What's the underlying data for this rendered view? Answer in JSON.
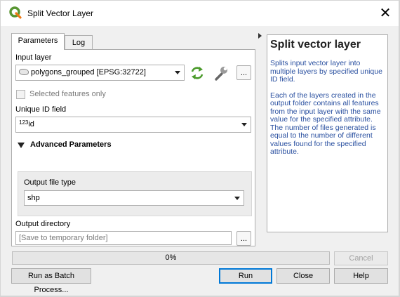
{
  "window": {
    "title": "Split Vector Layer",
    "close_glyph": "✕"
  },
  "tabs": [
    {
      "label": "Parameters"
    },
    {
      "label": "Log"
    }
  ],
  "params": {
    "input_layer_label": "Input layer",
    "input_layer_value": "polygons_grouped [EPSG:32722]",
    "selected_only_label": "Selected features only",
    "unique_id_label": "Unique ID field",
    "unique_id_type_badge": "123",
    "unique_id_value": "id",
    "advanced_label": "Advanced Parameters",
    "output_type_label": "Output file type",
    "output_type_value": "shp",
    "output_dir_label": "Output directory",
    "output_dir_placeholder": "[Save to temporary folder]",
    "browse_label": "..."
  },
  "help": {
    "title": "Split vector layer",
    "para1": "Splits input vector layer into multiple layers by specified unique ID field.",
    "para2": "Each of the layers created in the output folder contains all features from the input layer with the same value for the specified attribute. The number of files generated is equal to the number of different values found for the specified attribute."
  },
  "progress": {
    "text": "0%",
    "value": 0
  },
  "buttons": {
    "cancel": "Cancel",
    "batch": "Run as Batch Process...",
    "run": "Run",
    "close": "Close",
    "help": "Help"
  },
  "icons": {
    "app": "qgis-logo-icon",
    "refresh": "iterate-icon",
    "settings": "wrench-icon",
    "polygon": "polygon-layer-icon",
    "collapse": "triangle-down-icon",
    "splitter": "triangle-right-icon"
  },
  "colors": {
    "accent": "#0078d7",
    "help_text": "#2a50a0",
    "qgis_green": "#589632"
  }
}
